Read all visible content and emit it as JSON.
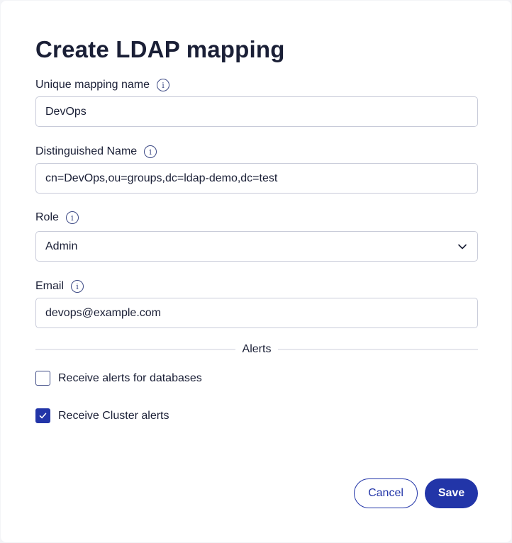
{
  "dialog": {
    "title": "Create LDAP mapping"
  },
  "fields": {
    "name": {
      "label": "Unique mapping name",
      "value": "DevOps"
    },
    "dn": {
      "label": "Distinguished Name",
      "value": "cn=DevOps,ou=groups,dc=ldap-demo,dc=test"
    },
    "role": {
      "label": "Role",
      "value": "Admin"
    },
    "email": {
      "label": "Email",
      "value": "devops@example.com"
    }
  },
  "alerts": {
    "section_label": "Alerts",
    "databases": {
      "label": "Receive alerts for databases",
      "checked": false
    },
    "cluster": {
      "label": "Receive Cluster alerts",
      "checked": true
    }
  },
  "actions": {
    "cancel_label": "Cancel",
    "save_label": "Save"
  },
  "colors": {
    "primary": "#2235a8",
    "border": "#c8cbd9",
    "text": "#1a1f36"
  },
  "icons": {
    "info": "info-circle-icon",
    "dropdown": "chevron-down-icon",
    "check": "check-icon"
  }
}
